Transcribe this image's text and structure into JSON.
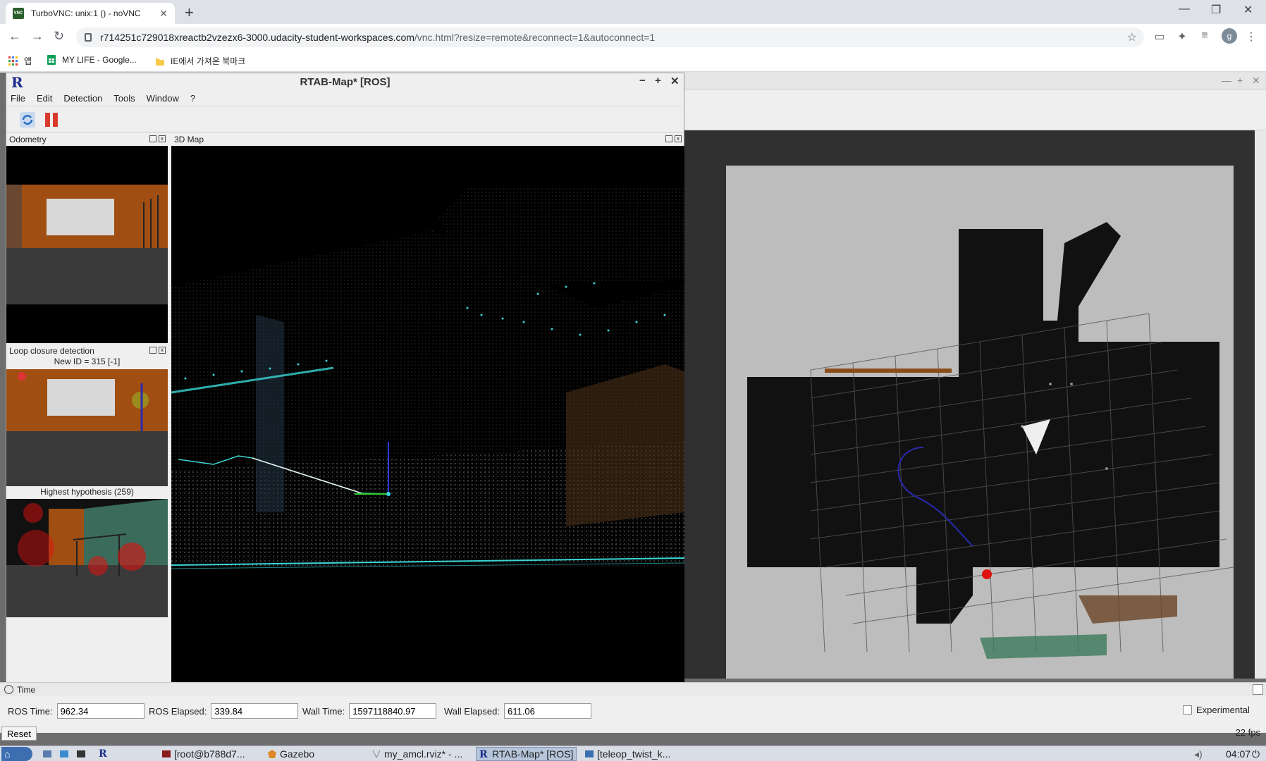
{
  "browser": {
    "tab_title": "TurboVNC: unix:1 () - noVNC",
    "url_host": "r714251c729018xreactb2vzezx6-3000.udacity-student-workspaces.com",
    "url_path": "/vnc.html?resize=remote&reconnect=1&autoconnect=1",
    "profile_initial": "g",
    "bookmarks": [
      {
        "label": "앱",
        "icon": "apps-icon"
      },
      {
        "label": "MY LIFE - Google...",
        "icon": "sheets-icon"
      },
      {
        "label": "IE에서 가져온 북마크",
        "icon": "folder-icon"
      }
    ]
  },
  "rtab": {
    "title": "RTAB-Map* [ROS]",
    "logo": "R",
    "menu": [
      "File",
      "Edit",
      "Detection",
      "Tools",
      "Window",
      "?"
    ],
    "docks": {
      "odometry": "Odometry",
      "map3d": "3D Map",
      "loop": "Loop closure detection",
      "new_id": "New ID = 315 [-1]",
      "hypothesis": "Highest hypothesis (259)"
    }
  },
  "time": {
    "panel_title": "Time",
    "ros_time_label": "ROS Time:",
    "ros_time": "962.34",
    "ros_elapsed_label": "ROS Elapsed:",
    "ros_elapsed": "339.84",
    "wall_time_label": "Wall Time:",
    "wall_time": "1597118840.97",
    "wall_elapsed_label": "Wall Elapsed:",
    "wall_elapsed": "611.06",
    "experimental": "Experimental",
    "reset": "Reset",
    "fps": "22 fps"
  },
  "taskbar": {
    "items": [
      "[root@b788d7...",
      "Gazebo",
      "my_amcl.rviz* - ...",
      "RTAB-Map* [ROS]",
      "[teleop_twist_k..."
    ],
    "clock": "04:07"
  },
  "colors": {
    "accent": "#1a73e8",
    "rtab_blue": "#1a2e8a",
    "cloud_cyan": "#3ad6d6",
    "wall_brown": "#a0521a"
  }
}
